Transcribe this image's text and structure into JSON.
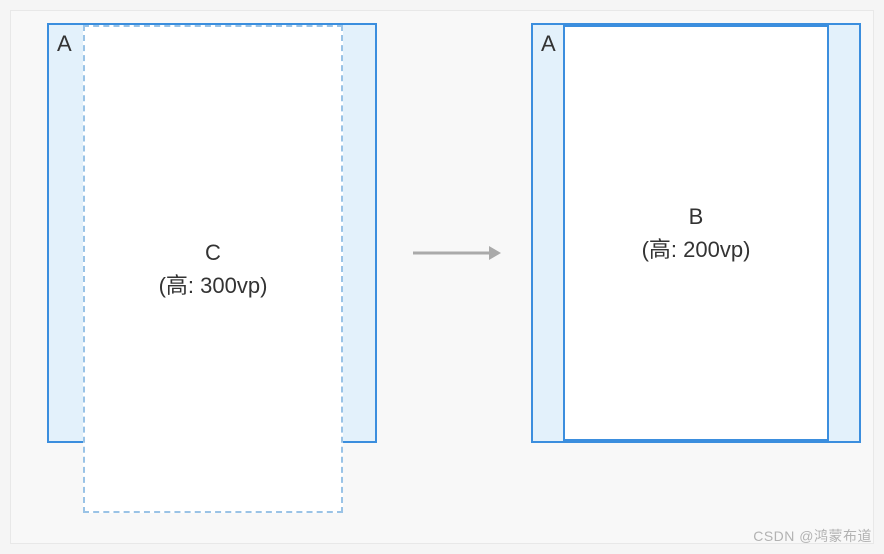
{
  "left": {
    "container_label": "A",
    "child_name": "C",
    "child_height_label": "(高: 300vp)"
  },
  "right": {
    "container_label": "A",
    "child_name": "B",
    "child_height_label": "(高: 200vp)"
  },
  "watermark": "CSDN @鸿蒙布道"
}
